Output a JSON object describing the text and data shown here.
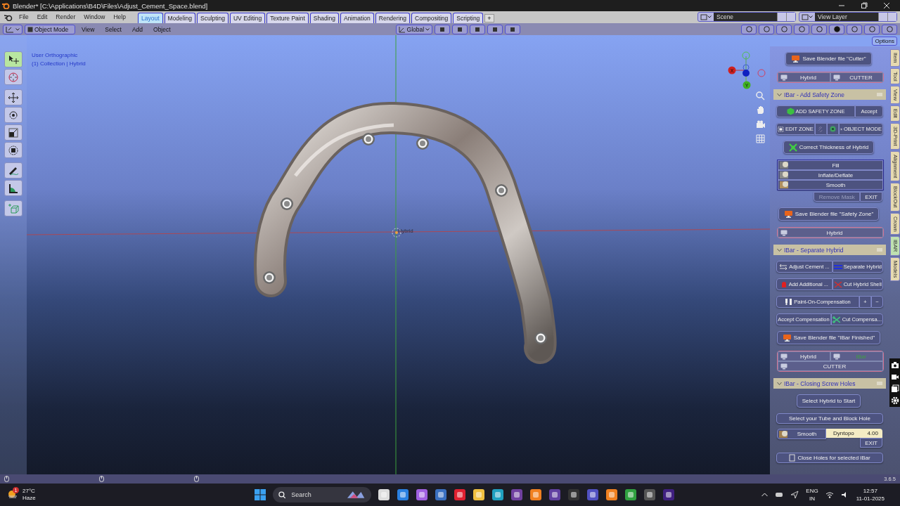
{
  "window": {
    "title": "Blender* [C:\\Applications\\B4D\\Files\\Adjust_Cement_Space.blend]"
  },
  "menus": [
    "File",
    "Edit",
    "Render",
    "Window",
    "Help"
  ],
  "workspaces": [
    {
      "label": "Layout",
      "selected": true
    },
    {
      "label": "Modeling",
      "selected": false
    },
    {
      "label": "Sculpting",
      "selected": false
    },
    {
      "label": "UV Editing",
      "selected": false
    },
    {
      "label": "Texture Paint",
      "selected": false
    },
    {
      "label": "Shading",
      "selected": false
    },
    {
      "label": "Animation",
      "selected": false
    },
    {
      "label": "Rendering",
      "selected": false
    },
    {
      "label": "Compositing",
      "selected": false
    },
    {
      "label": "Scripting",
      "selected": false
    }
  ],
  "add_workspace": "+",
  "scene": "Scene",
  "view_layer": "View Layer",
  "header": {
    "mode": "Object Mode",
    "menus": [
      "View",
      "Select",
      "Add",
      "Object"
    ],
    "orientation": "Global"
  },
  "tools": [
    {
      "kind": "select",
      "selected": true
    },
    {
      "kind": "cursor",
      "selected": false
    },
    {
      "kind": "move",
      "selected": false
    },
    {
      "kind": "rotate",
      "selected": false
    },
    {
      "kind": "scale",
      "selected": false
    },
    {
      "kind": "transform",
      "selected": false
    },
    {
      "kind": "annotate",
      "selected": false
    },
    {
      "kind": "measure",
      "selected": false
    },
    {
      "kind": "add_cube",
      "selected": false
    }
  ],
  "viewport": {
    "view_name": "User Orthographic",
    "collection": "(1) Collection | Hybrid",
    "object_label": "Hybrid",
    "gizmo_labels": [
      "X",
      "Y"
    ]
  },
  "options": "Options",
  "panel": [
    {
      "kind": "button",
      "label": "Save Blender file \"Cutter\""
    },
    {
      "kind": "objects",
      "items": [
        {
          "label": "Hybrid",
          "active": false
        },
        {
          "label": "CUTTER",
          "active": false
        }
      ]
    },
    {
      "kind": "section",
      "title": "IBar - Add Safety Zone",
      "expanded": true
    },
    {
      "kind": "pair",
      "items": [
        {
          "label": "ADD SAFETY ZONE"
        },
        {
          "label": "Accept"
        }
      ]
    },
    {
      "kind": "pair",
      "items": [
        {
          "label": "EDIT ZONE"
        },
        {
          "kind": "icon",
          "disabled": true
        },
        {
          "kind": "icon",
          "disabled": false
        },
        {
          "label": "OBJECT MODE"
        }
      ]
    },
    {
      "kind": "button",
      "label": "Correct Thickness of Hybrid"
    },
    {
      "kind": "brushes",
      "items": [
        "Fill",
        "Inflate/Deflate",
        "Smooth"
      ]
    },
    {
      "kind": "subrow",
      "items": [
        {
          "label": "Remove Mask",
          "disabled": true
        },
        {
          "label": "EXIT"
        }
      ]
    },
    {
      "kind": "button",
      "label": "Save Blender file \"Safety Zone\""
    },
    {
      "kind": "objects",
      "items": [
        {
          "label": "Hybrid",
          "active": false
        }
      ]
    },
    {
      "kind": "section",
      "title": "IBar - Separate Hybrid",
      "expanded": true
    },
    {
      "kind": "pair",
      "items": [
        {
          "label": "Adjust Cement ..."
        },
        {
          "label": "Separate Hybrid"
        }
      ]
    },
    {
      "kind": "pair",
      "items": [
        {
          "label": "Add Additional ..."
        },
        {
          "label": "Cut Hybrid Shell"
        }
      ]
    },
    {
      "kind": "pair",
      "items": [
        {
          "label": "Paint-On-Compensation"
        },
        {
          "label": "+"
        },
        {
          "label": "−"
        }
      ]
    },
    {
      "kind": "pair",
      "items": [
        {
          "label": "Accept Compensation"
        },
        {
          "label": "Cut Compensa..."
        }
      ]
    },
    {
      "kind": "button",
      "label": "Save Blender file \"IBar Finished\""
    },
    {
      "kind": "objects",
      "items": [
        {
          "label": "Hybrid",
          "active": false
        },
        {
          "label": "IBar",
          "active": true
        },
        {
          "label": "CUTTER",
          "active": false
        }
      ]
    },
    {
      "kind": "section",
      "title": "IBar - Closing Screw Holes",
      "expanded": true
    },
    {
      "kind": "button",
      "label": "Select Hybrid to Start"
    },
    {
      "kind": "wide",
      "label": "Select your Tube and Block Hole"
    },
    {
      "kind": "brush_setting",
      "brush": "Smooth",
      "field_label": "Dyntopo",
      "field_value": "4.00"
    },
    {
      "kind": "subrow",
      "items": [
        {
          "label": "EXIT"
        }
      ]
    },
    {
      "kind": "wide",
      "label": "Close Holes for selected iBar"
    }
  ],
  "side_tabs": [
    {
      "label": "Item",
      "selected": false
    },
    {
      "label": "Tool",
      "selected": false
    },
    {
      "label": "View",
      "selected": false
    },
    {
      "label": "Edit",
      "selected": false
    },
    {
      "label": "3D-Print",
      "selected": false
    },
    {
      "label": "Alignment",
      "selected": false
    },
    {
      "label": "BlockOut",
      "selected": false
    },
    {
      "label": "Crown",
      "selected": false
    },
    {
      "label": "IBAR",
      "selected": true
    },
    {
      "label": "Models",
      "selected": false
    }
  ],
  "version": "3.6.5",
  "taskbar": {
    "weather": {
      "badge": "1",
      "temperature": "27°C",
      "condition": "Haze"
    },
    "search": {
      "placeholder": "Search"
    },
    "language": [
      "ENG",
      "IN"
    ],
    "time": "12:57",
    "date": "11-01-2025"
  }
}
